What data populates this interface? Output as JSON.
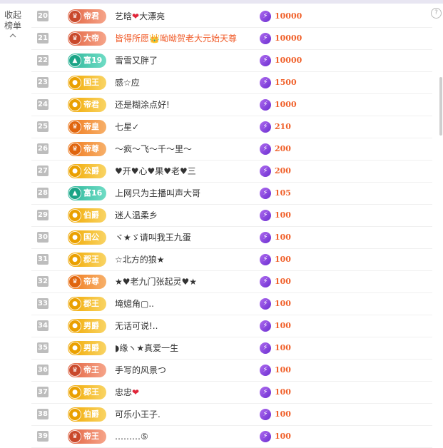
{
  "side": {
    "collapse_label": "收起榜单",
    "collapse_line1": "收起",
    "collapse_line2": "榜单",
    "chevron_icon": "chevron-up-icon"
  },
  "help_icon": "?",
  "colors": {
    "score": "#f0602a",
    "rank_bg": "#bdbdbd",
    "highlight_name": "#f05a28"
  },
  "rows": [
    {
      "rank": "20",
      "badge": "帝君",
      "badge_color": "red",
      "name": "艺晗",
      "heart": "❤",
      "name_suffix": "大漂亮",
      "score": "10000"
    },
    {
      "rank": "21",
      "badge": "大帝",
      "badge_color": "red",
      "name": "皆得所愿",
      "crown": "👑",
      "name_suffix": "呦呦贺老大元始天尊",
      "score": "10000",
      "highlight": true
    },
    {
      "rank": "22",
      "badge": "富19",
      "badge_color": "teal",
      "name": "雪雪又胖了",
      "score": "10000"
    },
    {
      "rank": "23",
      "badge": "国王",
      "badge_color": "gold",
      "name": "感☆应",
      "score": "1500"
    },
    {
      "rank": "24",
      "badge": "帝君",
      "badge_color": "gold",
      "name": "还是糊涂点好!",
      "score": "1000"
    },
    {
      "rank": "25",
      "badge": "帝皇",
      "badge_color": "orange",
      "name": "七星✓",
      "score": "210"
    },
    {
      "rank": "26",
      "badge": "帝尊",
      "badge_color": "orange",
      "name": "～疯～飞～千～里～",
      "score": "200"
    },
    {
      "rank": "27",
      "badge": "公爵",
      "badge_color": "gold",
      "name": "♥开♥心♥果♥老♥三",
      "score": "200"
    },
    {
      "rank": "28",
      "badge": "富16",
      "badge_color": "teal",
      "name": "上网只为主播叫声大哥",
      "score": "105"
    },
    {
      "rank": "29",
      "badge": "伯爵",
      "badge_color": "gold",
      "name": "迷人温柔乡",
      "score": "100"
    },
    {
      "rank": "30",
      "badge": "国公",
      "badge_color": "gold",
      "name": "ヾ★ゞ请叫我王九蛋",
      "score": "100"
    },
    {
      "rank": "31",
      "badge": "郡王",
      "badge_color": "gold",
      "name": "☆北方的狼★",
      "score": "100"
    },
    {
      "rank": "32",
      "badge": "帝尊",
      "badge_color": "orange",
      "name": "★♥老九门张起灵♥★",
      "score": "100"
    },
    {
      "rank": "33",
      "badge": "郡王",
      "badge_color": "gold",
      "name": "埯嬑角▢..",
      "score": "100"
    },
    {
      "rank": "34",
      "badge": "男爵",
      "badge_color": "gold",
      "name": "无话可说!..",
      "score": "100"
    },
    {
      "rank": "35",
      "badge": "男爵",
      "badge_color": "gold",
      "name": "◗缘ヽ★真爱一生",
      "score": "100"
    },
    {
      "rank": "36",
      "badge": "帝王",
      "badge_color": "red",
      "name": "手写的风景つ",
      "score": "100"
    },
    {
      "rank": "37",
      "badge": "郡王",
      "badge_color": "gold",
      "name": "忠忠",
      "heart": "❤",
      "score": "100"
    },
    {
      "rank": "38",
      "badge": "伯爵",
      "badge_color": "gold",
      "name": "可乐小王子.",
      "score": "100"
    },
    {
      "rank": "39",
      "badge": "帝王",
      "badge_color": "red",
      "name": "………⑤",
      "score": "100"
    }
  ]
}
